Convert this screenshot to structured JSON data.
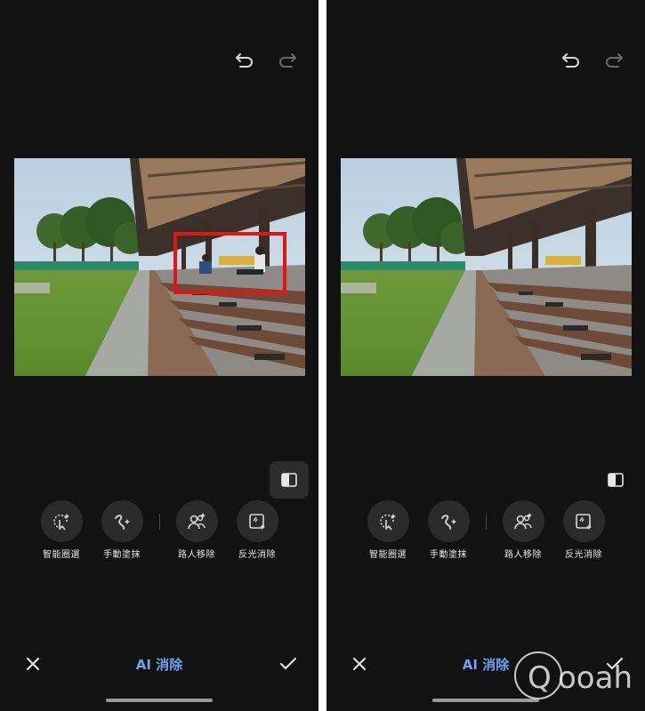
{
  "colors": {
    "screen_bg": "#121212",
    "tool_circle": "#2b2b2b",
    "accent": "#6fa3f0",
    "highlight_box": "#e31414",
    "icon": "#d8d8d8"
  },
  "icons": {
    "undo": "undo-arrow-icon",
    "redo": "redo-arrow-icon",
    "compare": "split-compare-icon",
    "close": "close-x-icon",
    "confirm": "checkmark-icon"
  },
  "left_screen": {
    "tools": [
      {
        "label": "智能圈選",
        "icon": "smart-select-icon"
      },
      {
        "label": "手動塗抹",
        "icon": "manual-brush-icon"
      },
      {
        "label": "路人移除",
        "icon": "remove-people-icon"
      },
      {
        "label": "反光消除",
        "icon": "reflection-remove-icon"
      }
    ],
    "mode_title": "AI 消除",
    "highlight_shown": true
  },
  "right_screen": {
    "tools": [
      {
        "label": "智能圈選",
        "icon": "smart-select-icon"
      },
      {
        "label": "手動塗抹",
        "icon": "manual-brush-icon"
      },
      {
        "label": "路人移除",
        "icon": "remove-people-icon"
      },
      {
        "label": "反光消除",
        "icon": "reflection-remove-icon"
      }
    ],
    "mode_title": "AI 消除",
    "people_removed": true
  },
  "watermark": {
    "text": "Qooah"
  }
}
